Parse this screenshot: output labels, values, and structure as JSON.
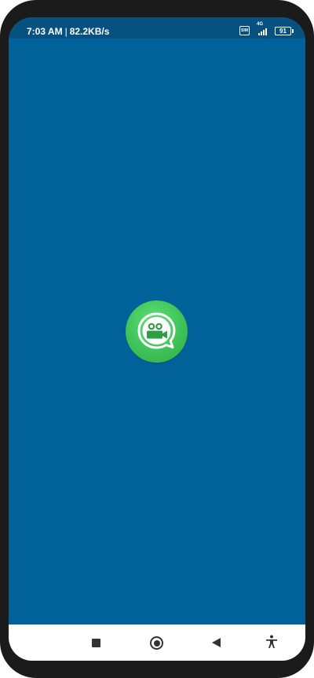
{
  "status_bar": {
    "time": "7:03 AM",
    "separator": "|",
    "network_speed": "82.2KB/s",
    "network_type": "4G",
    "battery_level": "91",
    "icons": [
      "sim-icon",
      "signal-icon",
      "battery-icon"
    ]
  },
  "splash": {
    "logo_icon": "video-camera-chat-bubble-icon",
    "background_color": "#006298",
    "logo_color": "#3fc257"
  },
  "nav_bar": {
    "buttons": [
      "recents-button",
      "home-button",
      "back-button",
      "accessibility-button"
    ]
  }
}
